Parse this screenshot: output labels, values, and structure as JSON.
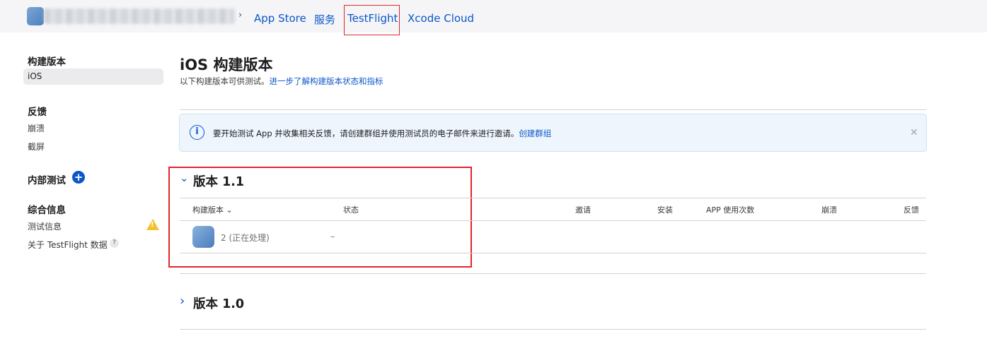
{
  "topbar": {
    "separator": "›",
    "tabs": [
      {
        "label": "App Store"
      },
      {
        "label": "服务"
      },
      {
        "label": "TestFlight",
        "active": true
      },
      {
        "label": "Xcode Cloud"
      }
    ]
  },
  "sidebar": {
    "sections": [
      {
        "heading": "构建版本",
        "items": [
          "iOS"
        ]
      },
      {
        "heading": "反馈",
        "items": [
          "崩溃",
          "截屏"
        ]
      },
      {
        "heading": "内部测试",
        "items": []
      },
      {
        "heading": "综合信息",
        "items": [
          "测试信息",
          "关于 TestFlight 数据"
        ]
      }
    ],
    "selected_item": "iOS",
    "plus_glyph": "+",
    "warning_glyph": "!",
    "help_glyph": "?"
  },
  "main": {
    "title": "iOS 构建版本",
    "subtitle": "以下构建版本可供测试。",
    "subtitle_link": "进一步了解构建版本状态和指标",
    "info_banner": {
      "icon_glyph": "i",
      "text": "要开始测试 App 并收集相关反馈，请创建群组并使用测试员的电子邮件来进行邀请。",
      "link": "创建群组",
      "close_glyph": "✕"
    },
    "versions": [
      {
        "title": "版本 1.1",
        "expanded": true,
        "chevron": "⌄",
        "columns": [
          "构建版本 ⌄",
          "状态",
          "邀请",
          "安装",
          "APP 使用次数",
          "崩溃",
          "反馈"
        ],
        "rows": [
          {
            "build": "2 (正在处理)",
            "status": "–"
          }
        ]
      },
      {
        "title": "版本 1.0",
        "expanded": false,
        "chevron": "›"
      }
    ]
  },
  "colors": {
    "accent": "#0b57c9",
    "highlight": "#e0262d",
    "warning": "#f2c230",
    "info_bg": "#eef5fd"
  }
}
